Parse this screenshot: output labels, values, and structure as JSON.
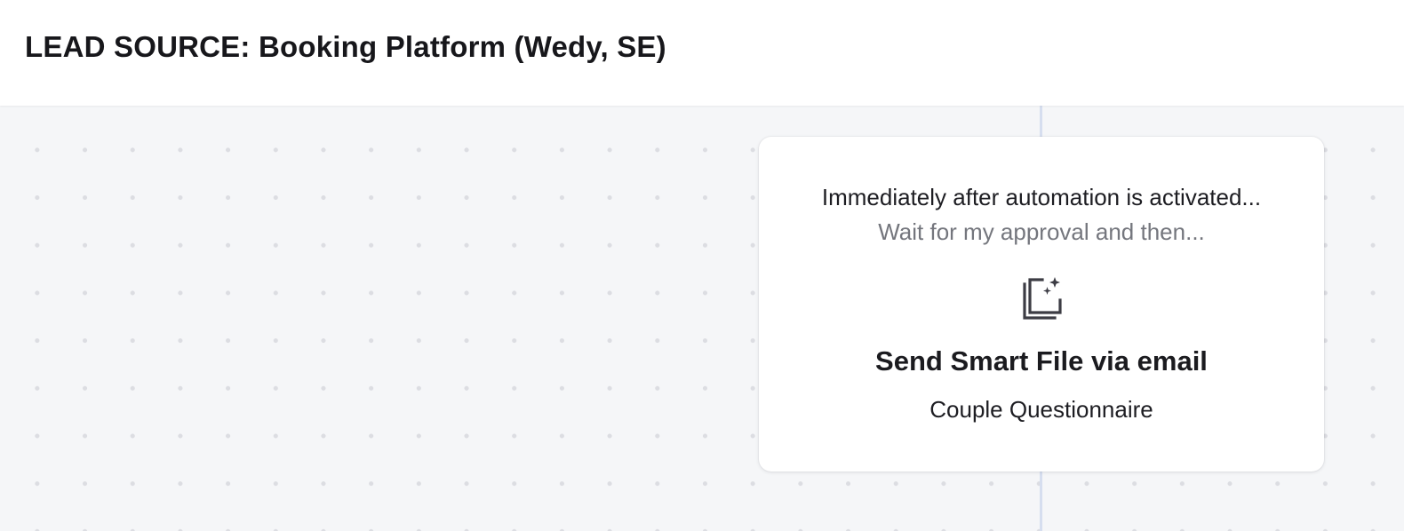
{
  "header": {
    "title": "LEAD SOURCE: Booking Platform (Wedy, SE)"
  },
  "step_card": {
    "trigger_text": "Immediately after automation is activated...",
    "wait_text": "Wait for my approval and then...",
    "icon": "smart-file-icon",
    "action_title": "Send Smart File via email",
    "action_detail": "Couple Questionnaire"
  },
  "colors": {
    "canvas_background": "#f5f6f8",
    "canvas_dot": "#dcdde2",
    "connector": "#d6deef",
    "card_background": "#ffffff",
    "muted_text": "#74767d",
    "icon": "#3c3c44"
  }
}
